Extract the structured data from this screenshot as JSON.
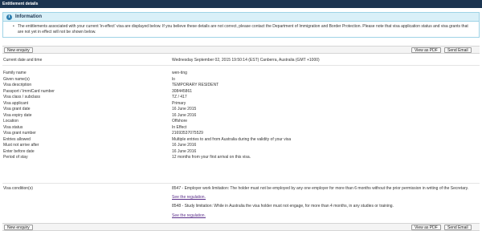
{
  "window": {
    "title": "Entitlement details"
  },
  "info": {
    "heading": "Information",
    "text": "The entitlements associated with your current 'in-effect' visa are displayed below. If you believe these details are not correct, please contact the Department of Immigration and Border Protection. Please note that visa application status and visa grants that are not yet in effect will not be shown below."
  },
  "toolbar": {
    "new_enquiry": "New enquiry",
    "view_pdf": "View as PDF",
    "send_email": "Send Email"
  },
  "current": {
    "label": "Current date and time",
    "value": "Wednesday September 02, 2015 19:50:14 (EST) Canberra, Australia (GMT +1000)"
  },
  "details": [
    {
      "label": "Family name",
      "value": "wen-ting"
    },
    {
      "label": "Given name(s)",
      "value": "lo"
    },
    {
      "label": "Visa description",
      "value": "TEMPORARY RESIDENT"
    },
    {
      "label": "Passport / ImmiCard number",
      "value": "308445861"
    },
    {
      "label": "Visa class / subclass",
      "value": "TZ / 417"
    },
    {
      "label": "Visa applicant",
      "value": "Primary"
    },
    {
      "label": "Visa grant date",
      "value": "16 June 2015"
    },
    {
      "label": "Visa expiry date",
      "value": "16 June 2016"
    },
    {
      "label": "Location",
      "value": "Offshore"
    },
    {
      "label": "Visa status",
      "value": "In Effect"
    },
    {
      "label": "Visa grant number",
      "value": "21693537075529"
    },
    {
      "label": "Entries allowed",
      "value": "Multiple entries to and from Australia during the validity of your visa"
    },
    {
      "label": "Must not arrive after",
      "value": "16 June 2016"
    },
    {
      "label": "Enter before date",
      "value": "16 June 2016"
    },
    {
      "label": "Period of stay",
      "value": "12 months from your first arrival on this visa."
    }
  ],
  "conditions": {
    "label": "Visa condition(s)",
    "items": [
      {
        "text": "8547 - Employer work limitation: The holder must not be employed by any one employer for more than 6 months without the prior permission in writing of the Secretary.",
        "link": "See the regulation."
      },
      {
        "text": "8548 - Study limitation: While in Australia the visa holder must not engage, for more than 4 months, in any studies or training.",
        "link": "See the regulation."
      }
    ]
  }
}
